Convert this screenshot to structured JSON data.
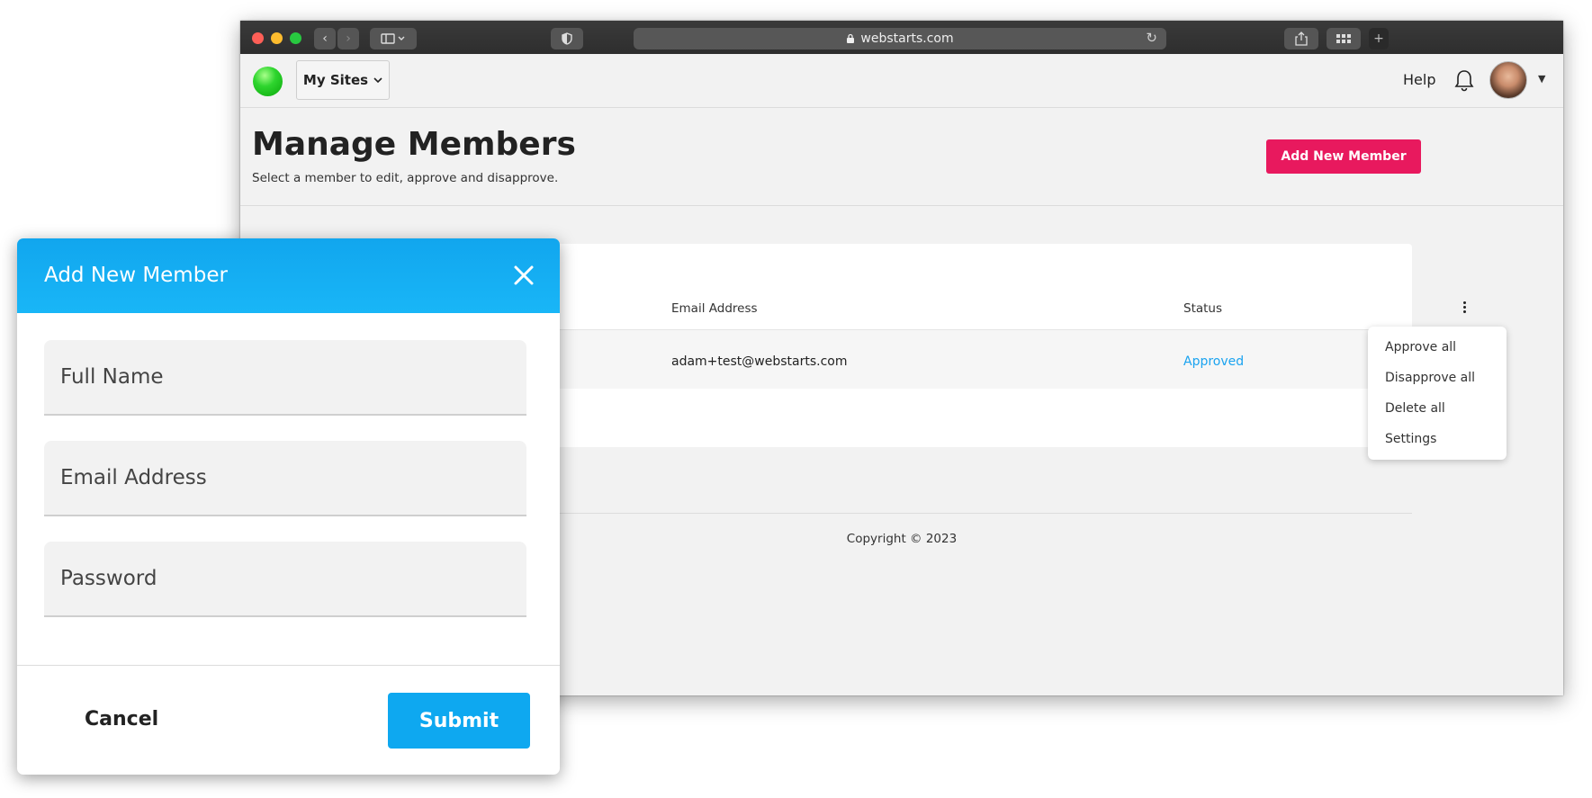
{
  "browser": {
    "url": "webstarts.com"
  },
  "appbar": {
    "sites_label": "My Sites",
    "help_label": "Help"
  },
  "page": {
    "title": "Manage Members",
    "subtitle": "Select a member to edit, approve and disapprove.",
    "add_button": "Add New Member"
  },
  "table": {
    "headers": [
      "Email Address",
      "Status"
    ],
    "rows": [
      {
        "email": "adam+test@webstarts.com",
        "status": "Approved"
      }
    ]
  },
  "menu": {
    "items": [
      "Approve all",
      "Disapprove all",
      "Delete all",
      "Settings"
    ]
  },
  "footer": {
    "copyright": "Copyright © 2023"
  },
  "modal": {
    "title": "Add New Member",
    "fields": [
      {
        "placeholder": "Full Name"
      },
      {
        "placeholder": "Email Address"
      },
      {
        "placeholder": "Password"
      }
    ],
    "cancel_label": "Cancel",
    "submit_label": "Submit"
  },
  "colors": {
    "accent_pink": "#e8195e",
    "modal_blue": "#19b6f7",
    "status_blue": "#1aa3f0",
    "logo_green": "#2ed52e"
  }
}
